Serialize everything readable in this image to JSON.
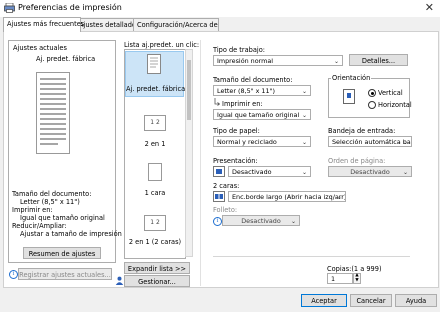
{
  "window": {
    "title": "Preferencias de impresión",
    "close_glyph": "✕"
  },
  "tabs": [
    "Ajustes más frecuentes",
    "Ajustes detallados",
    "Configuración/Acerca de"
  ],
  "current": {
    "heading": "Ajustes actuales",
    "preset_name": "Aj. predet. fábrica",
    "summary": [
      "Tamaño del documento:",
      "Letter (8,5\" x 11\")",
      "Imprimir en:",
      "Igual que tamaño original",
      "Reducir/Ampliar:",
      "Ajustar a tamaño de impresión"
    ],
    "reset_button": "Resumen de ajustes",
    "register_button": "Registrar ajustes actuales..."
  },
  "presets": {
    "heading": "Lista aj.predet. un clic:",
    "items": [
      "Aj. predet. fábrica",
      "2 en 1",
      "1 cara",
      "2 en 1 (2 caras)"
    ],
    "thumb_2in1": "1 2",
    "expand_button": "Expandir lista >>",
    "manage_button": "Gestionar..."
  },
  "settings": {
    "job_type_label": "Tipo de trabajo:",
    "job_type_value": "Impresión normal",
    "details_button": "Detalles...",
    "doc_size_label": "Tamaño del documento:",
    "doc_size_value": "Letter (8,5\" x 11\")",
    "print_on_label": "Imprimir en:",
    "print_on_value": "Igual que tamaño original",
    "orientation_label": "Orientación",
    "orientation_options": [
      "Vertical",
      "Horizontal"
    ],
    "orientation_selected": "Vertical",
    "paper_type_label": "Tipo de papel:",
    "paper_type_value": "Normal y reciclado",
    "input_tray_label": "Bandeja de entrada:",
    "input_tray_value": "Selección automática bandeja",
    "presentation_label": "Presentación:",
    "presentation_value": "Desactivado",
    "page_order_label": "Orden de página:",
    "page_order_value": "Desactivado",
    "duplex_label": "2 caras:",
    "duplex_value": "Enc.borde largo (Abrir hacia izq/arr)",
    "booklet_label": "Folleto:",
    "booklet_value": "Desactivado",
    "copies_label": "Copias:(1 a 999)",
    "copies_value": "1"
  },
  "footer": {
    "ok": "Aceptar",
    "cancel": "Cancelar",
    "help": "Ayuda"
  },
  "colors": {
    "accent": "#0078d7",
    "selected_bg": "#cce4f7"
  }
}
